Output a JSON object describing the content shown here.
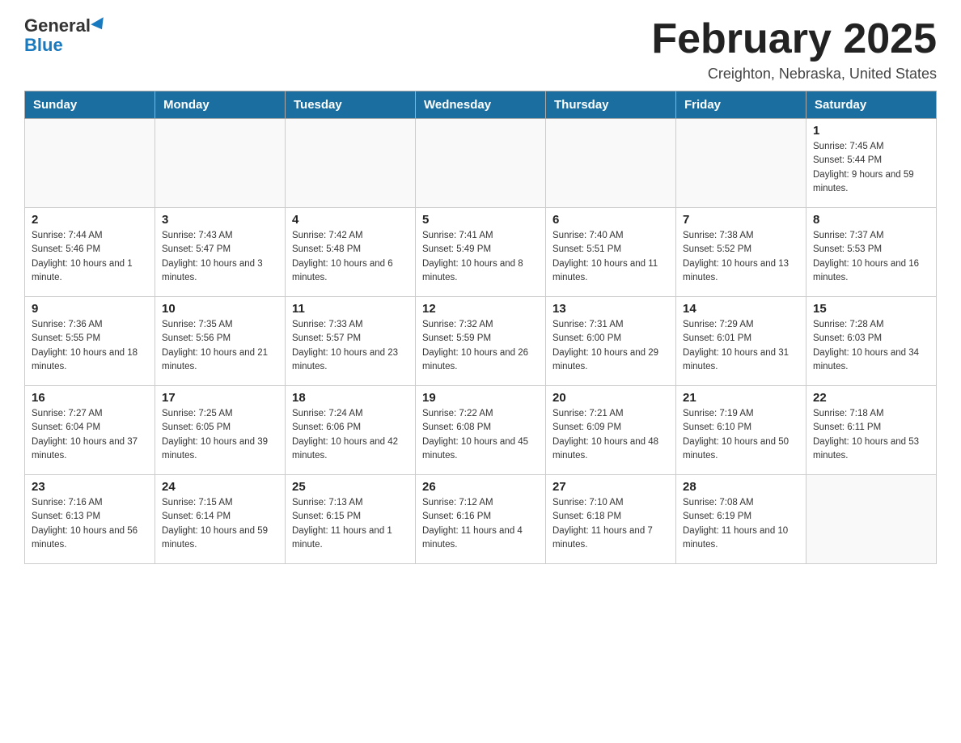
{
  "header": {
    "logo_general": "General",
    "logo_blue": "Blue",
    "month_title": "February 2025",
    "location": "Creighton, Nebraska, United States"
  },
  "days_of_week": [
    "Sunday",
    "Monday",
    "Tuesday",
    "Wednesday",
    "Thursday",
    "Friday",
    "Saturday"
  ],
  "weeks": [
    [
      {
        "day": "",
        "info": ""
      },
      {
        "day": "",
        "info": ""
      },
      {
        "day": "",
        "info": ""
      },
      {
        "day": "",
        "info": ""
      },
      {
        "day": "",
        "info": ""
      },
      {
        "day": "",
        "info": ""
      },
      {
        "day": "1",
        "info": "Sunrise: 7:45 AM\nSunset: 5:44 PM\nDaylight: 9 hours and 59 minutes."
      }
    ],
    [
      {
        "day": "2",
        "info": "Sunrise: 7:44 AM\nSunset: 5:46 PM\nDaylight: 10 hours and 1 minute."
      },
      {
        "day": "3",
        "info": "Sunrise: 7:43 AM\nSunset: 5:47 PM\nDaylight: 10 hours and 3 minutes."
      },
      {
        "day": "4",
        "info": "Sunrise: 7:42 AM\nSunset: 5:48 PM\nDaylight: 10 hours and 6 minutes."
      },
      {
        "day": "5",
        "info": "Sunrise: 7:41 AM\nSunset: 5:49 PM\nDaylight: 10 hours and 8 minutes."
      },
      {
        "day": "6",
        "info": "Sunrise: 7:40 AM\nSunset: 5:51 PM\nDaylight: 10 hours and 11 minutes."
      },
      {
        "day": "7",
        "info": "Sunrise: 7:38 AM\nSunset: 5:52 PM\nDaylight: 10 hours and 13 minutes."
      },
      {
        "day": "8",
        "info": "Sunrise: 7:37 AM\nSunset: 5:53 PM\nDaylight: 10 hours and 16 minutes."
      }
    ],
    [
      {
        "day": "9",
        "info": "Sunrise: 7:36 AM\nSunset: 5:55 PM\nDaylight: 10 hours and 18 minutes."
      },
      {
        "day": "10",
        "info": "Sunrise: 7:35 AM\nSunset: 5:56 PM\nDaylight: 10 hours and 21 minutes."
      },
      {
        "day": "11",
        "info": "Sunrise: 7:33 AM\nSunset: 5:57 PM\nDaylight: 10 hours and 23 minutes."
      },
      {
        "day": "12",
        "info": "Sunrise: 7:32 AM\nSunset: 5:59 PM\nDaylight: 10 hours and 26 minutes."
      },
      {
        "day": "13",
        "info": "Sunrise: 7:31 AM\nSunset: 6:00 PM\nDaylight: 10 hours and 29 minutes."
      },
      {
        "day": "14",
        "info": "Sunrise: 7:29 AM\nSunset: 6:01 PM\nDaylight: 10 hours and 31 minutes."
      },
      {
        "day": "15",
        "info": "Sunrise: 7:28 AM\nSunset: 6:03 PM\nDaylight: 10 hours and 34 minutes."
      }
    ],
    [
      {
        "day": "16",
        "info": "Sunrise: 7:27 AM\nSunset: 6:04 PM\nDaylight: 10 hours and 37 minutes."
      },
      {
        "day": "17",
        "info": "Sunrise: 7:25 AM\nSunset: 6:05 PM\nDaylight: 10 hours and 39 minutes."
      },
      {
        "day": "18",
        "info": "Sunrise: 7:24 AM\nSunset: 6:06 PM\nDaylight: 10 hours and 42 minutes."
      },
      {
        "day": "19",
        "info": "Sunrise: 7:22 AM\nSunset: 6:08 PM\nDaylight: 10 hours and 45 minutes."
      },
      {
        "day": "20",
        "info": "Sunrise: 7:21 AM\nSunset: 6:09 PM\nDaylight: 10 hours and 48 minutes."
      },
      {
        "day": "21",
        "info": "Sunrise: 7:19 AM\nSunset: 6:10 PM\nDaylight: 10 hours and 50 minutes."
      },
      {
        "day": "22",
        "info": "Sunrise: 7:18 AM\nSunset: 6:11 PM\nDaylight: 10 hours and 53 minutes."
      }
    ],
    [
      {
        "day": "23",
        "info": "Sunrise: 7:16 AM\nSunset: 6:13 PM\nDaylight: 10 hours and 56 minutes."
      },
      {
        "day": "24",
        "info": "Sunrise: 7:15 AM\nSunset: 6:14 PM\nDaylight: 10 hours and 59 minutes."
      },
      {
        "day": "25",
        "info": "Sunrise: 7:13 AM\nSunset: 6:15 PM\nDaylight: 11 hours and 1 minute."
      },
      {
        "day": "26",
        "info": "Sunrise: 7:12 AM\nSunset: 6:16 PM\nDaylight: 11 hours and 4 minutes."
      },
      {
        "day": "27",
        "info": "Sunrise: 7:10 AM\nSunset: 6:18 PM\nDaylight: 11 hours and 7 minutes."
      },
      {
        "day": "28",
        "info": "Sunrise: 7:08 AM\nSunset: 6:19 PM\nDaylight: 11 hours and 10 minutes."
      },
      {
        "day": "",
        "info": ""
      }
    ]
  ]
}
